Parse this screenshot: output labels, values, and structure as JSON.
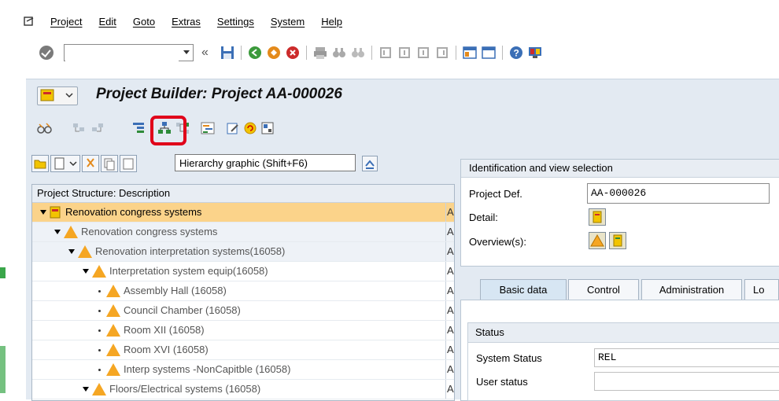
{
  "menu": [
    "Project",
    "Edit",
    "Goto",
    "Extras",
    "Settings",
    "System",
    "Help"
  ],
  "command_field": {
    "value": ""
  },
  "title": "Project Builder: Project AA-000026",
  "tooltip": "Hierarchy graphic   (Shift+F6)",
  "tree": {
    "header": "Project Structure: Description",
    "rows": [
      {
        "label": "Renovation congress systems",
        "col": "A"
      },
      {
        "label": "Renovation congress systems",
        "col": "A"
      },
      {
        "label": "Renovation interpretation systems(16058)",
        "col": "A"
      },
      {
        "label": "Interpretation system equip(16058)",
        "col": "A"
      },
      {
        "label": "Assembly Hall (16058)",
        "col": "A"
      },
      {
        "label": "Council Chamber (16058)",
        "col": "A"
      },
      {
        "label": "Room XII (16058)",
        "col": "A"
      },
      {
        "label": "Room XVI (16058)",
        "col": "A"
      },
      {
        "label": "Interp systems -NonCapitble (16058)",
        "col": "A"
      },
      {
        "label": "Floors/Electrical systems (16058)",
        "col": "A"
      }
    ]
  },
  "identification": {
    "header": "Identification and view selection",
    "project_def_label": "Project Def.",
    "project_def_value": "AA-000026",
    "detail_label": "Detail:",
    "overview_label": "Overview(s):"
  },
  "tabs": [
    "Basic data",
    "Control",
    "Administration",
    "Lo"
  ],
  "status": {
    "header": "Status",
    "system_status_label": "System Status",
    "system_status_value": "REL",
    "user_status_label": "User status"
  },
  "colors": {
    "accent_bg": "#e3eaf2",
    "selected_row": "#fbd38a",
    "highlight_box": "#e0001a",
    "warning": "#f5a623"
  }
}
